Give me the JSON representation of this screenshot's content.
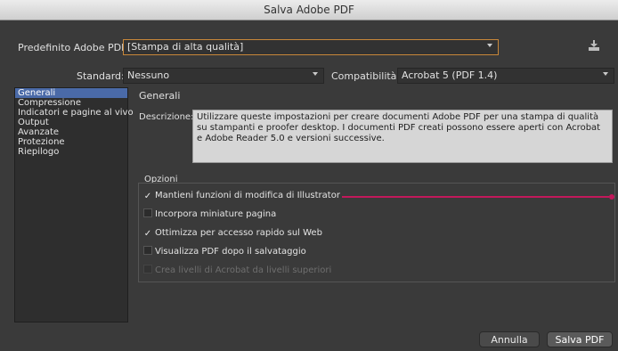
{
  "window": {
    "title": "Salva Adobe PDF"
  },
  "preset": {
    "label": "Predefinito Adobe PDF:",
    "value": "[Stampa di alta qualità]"
  },
  "standard": {
    "label": "Standard:",
    "value": "Nessuno"
  },
  "compatibility": {
    "label": "Compatibilità:",
    "value": "Acrobat 5 (PDF 1.4)"
  },
  "sidebar": {
    "items": [
      {
        "label": "Generali",
        "selected": true
      },
      {
        "label": "Compressione"
      },
      {
        "label": "Indicatori e pagine al vivo"
      },
      {
        "label": "Output"
      },
      {
        "label": "Avanzate"
      },
      {
        "label": "Protezione"
      },
      {
        "label": "Riepilogo"
      }
    ]
  },
  "panel": {
    "title": "Generali",
    "description_label": "Descrizione:",
    "description": "Utilizzare queste impostazioni per creare documenti Adobe PDF per una stampa di qualità su stampanti e proofer desktop. I documenti PDF creati possono essere aperti con Acrobat e Adobe Reader 5.0 e versioni successive."
  },
  "options": {
    "title": "Opzioni",
    "items": [
      {
        "label": "Mantieni funzioni di modifica di Illustrator",
        "checked": true
      },
      {
        "label": "Incorpora miniature pagina",
        "checked": false
      },
      {
        "label": "Ottimizza per accesso rapido sul Web",
        "checked": true
      },
      {
        "label": "Visualizza PDF dopo il salvataggio",
        "checked": false
      },
      {
        "label": "Crea livelli di Acrobat da livelli superiori",
        "checked": false,
        "disabled": true
      }
    ]
  },
  "buttons": {
    "cancel": "Annulla",
    "save": "Salva PDF"
  },
  "colors": {
    "accent_annotation": "#c2185b",
    "preset_border": "#c8873a",
    "selection": "#4a6aa8"
  }
}
